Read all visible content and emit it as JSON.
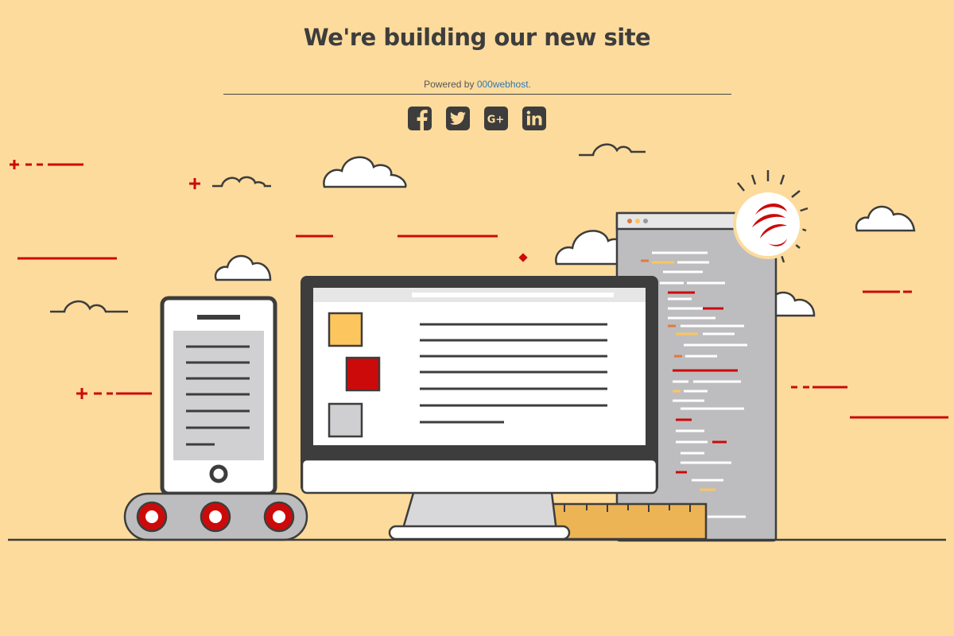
{
  "header": {
    "title": "We're building our new site",
    "powered_prefix": "Powered by ",
    "powered_link": "000webhost."
  },
  "social": {
    "links": [
      {
        "icon": "facebook-icon"
      },
      {
        "icon": "twitter-icon"
      },
      {
        "icon": "google-plus-icon"
      },
      {
        "icon": "linkedin-icon"
      }
    ]
  },
  "colors": {
    "background": "#FDDB9C",
    "dark": "#3d3d3d",
    "accent_red": "#CC0A0A",
    "accent_yellow": "#FDC55E",
    "grey": "#BDBDBF",
    "link": "#2a7ab8"
  }
}
